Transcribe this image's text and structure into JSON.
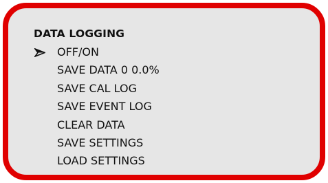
{
  "menu": {
    "title": "DATA LOGGING",
    "selected_index": 0,
    "cursor_icon": "arrowhead-right-icon",
    "items": [
      {
        "label": "OFF/ON"
      },
      {
        "label": "SAVE DATA 0 0.0%"
      },
      {
        "label": "SAVE CAL LOG"
      },
      {
        "label": "SAVE EVENT LOG"
      },
      {
        "label": "CLEAR DATA"
      },
      {
        "label": "SAVE SETTINGS"
      },
      {
        "label": "LOAD SETTINGS"
      }
    ]
  },
  "colors": {
    "frame_border": "#e00000",
    "panel_background": "#e6e6e6",
    "text": "#111111"
  }
}
